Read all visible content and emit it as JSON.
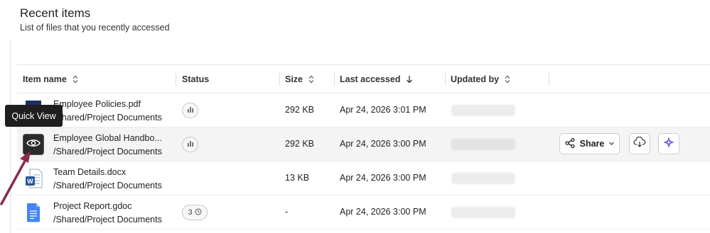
{
  "header": {
    "title": "Recent items",
    "subtitle": "List of files that you recently accessed"
  },
  "columns": {
    "item_name": "Item name",
    "status": "Status",
    "size": "Size",
    "last_accessed": "Last accessed",
    "updated_by": "Updated by"
  },
  "rows": [
    {
      "name": "Employee Policies.pdf",
      "path": "/Shared/Project Documents",
      "file_type": "pdf-file-icon",
      "status": "views",
      "size": "292 KB",
      "accessed": "Apr 24, 2026 3:01 PM"
    },
    {
      "name": "Employee Global Handbo...",
      "path": "/Shared/Project Documents",
      "file_type": "file-icon",
      "status": "views",
      "size": "292 KB",
      "accessed": "Apr 24, 2026 3:00 PM"
    },
    {
      "name": "Team Details.docx",
      "path": "/Shared/Project Documents",
      "file_type": "word-file-icon",
      "status": "",
      "size": "13 KB",
      "accessed": "Apr 24, 2026 3:00 PM"
    },
    {
      "name": "Project Report.gdoc",
      "path": "/Shared/Project Documents",
      "file_type": "gdoc-file-icon",
      "status": "3",
      "size": "-",
      "accessed": "Apr 24, 2026 3:00 PM"
    }
  ],
  "actions": {
    "share_label": "Share"
  },
  "tooltip": {
    "text": "Quick View"
  },
  "colors": {
    "arrow": "#8b2a4e",
    "word_blue": "#2b579a",
    "gdoc_blue": "#4285f4",
    "ai_purple": "#7b5cff"
  }
}
